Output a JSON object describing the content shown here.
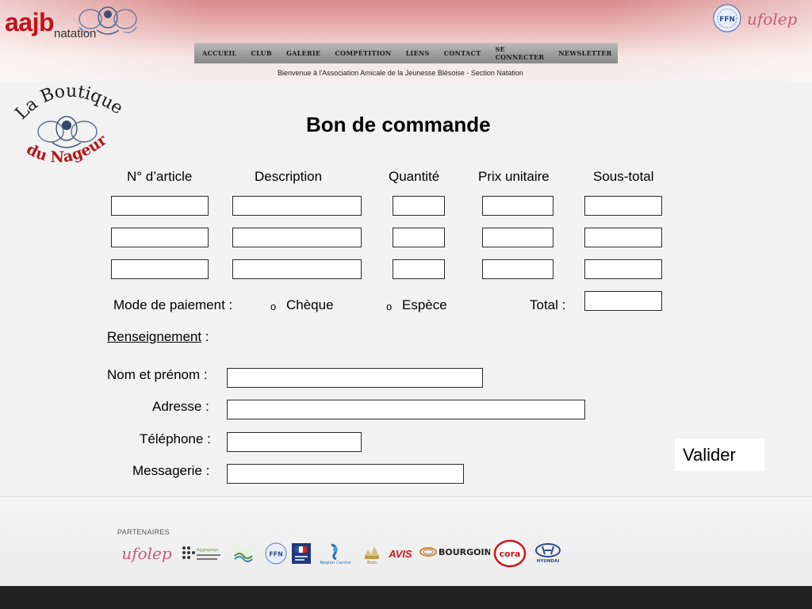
{
  "header": {
    "logo_main": "aajb",
    "logo_sub": "natation",
    "partner_top_ffn": "FFN",
    "partner_top_ufolep": "ufolep",
    "nav": [
      "ACCUEIL",
      "CLUB",
      "GALERIE",
      "COMPÉTITION",
      "LIENS",
      "CONTACT",
      "SE CONNECTER",
      "NEWSLETTER"
    ],
    "welcome": "Bienvenue à l'Association Amicale de la Jeunesse Blésoise - Section Natation"
  },
  "boutique_logo": {
    "line1": "La Boutique",
    "line2": "du Nageur"
  },
  "form": {
    "title": "Bon de commande",
    "columns": [
      "N° d’article",
      "Description",
      "Quantité",
      "Prix unitaire",
      "Sous-total"
    ],
    "rows": [
      [
        "",
        "",
        "",
        "",
        ""
      ],
      [
        "",
        "",
        "",
        "",
        ""
      ],
      [
        "",
        "",
        "",
        "",
        ""
      ]
    ],
    "payment_label": "Mode de paiement :",
    "payment_options": [
      "Chèque",
      "Espèce"
    ],
    "radio_glyph": "o",
    "total_label": "Total :",
    "total_value": "",
    "section_label": "Renseignement",
    "section_colon": " :",
    "fields": {
      "name_label": "Nom et prénom :",
      "address_label": "Adresse :",
      "phone_label": "Téléphone :",
      "email_label": "Messagerie :"
    },
    "submit_label": "Valider"
  },
  "footer": {
    "partners_title": "PARTENAIRES",
    "partners": [
      "ufolep",
      "Agglopolys",
      "Loir-et-Cher",
      "FFN",
      "République Française",
      "Région Centre",
      "Blois",
      "AVIS",
      "BOURGOIN",
      "cora",
      "HYUNDAI"
    ]
  },
  "colors": {
    "brand_red": "#c4121a",
    "nav_bg": "#9c9c9c",
    "bottom_bar": "#222222"
  }
}
